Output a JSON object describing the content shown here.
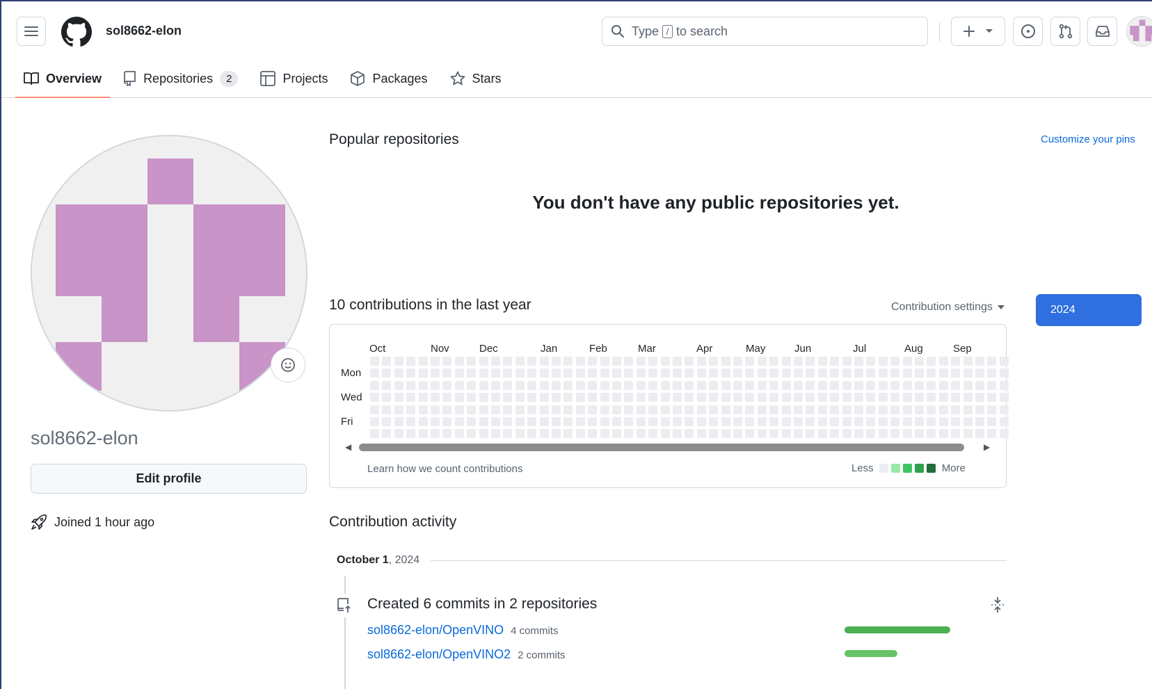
{
  "header": {
    "username": "sol8662-elon",
    "search_prefix": "Type",
    "search_key": "/",
    "search_suffix": "to search"
  },
  "tabs": [
    {
      "label": "Overview",
      "active": true
    },
    {
      "label": "Repositories",
      "count": "2"
    },
    {
      "label": "Projects"
    },
    {
      "label": "Packages"
    },
    {
      "label": "Stars"
    }
  ],
  "profile": {
    "name": "sol8662-elon",
    "edit_label": "Edit profile",
    "joined": "Joined 1 hour ago",
    "avatar_color": "#c994c7"
  },
  "popular": {
    "title": "Popular repositories",
    "customize": "Customize your pins",
    "empty_message": "You don't have any public repositories yet."
  },
  "contributions": {
    "title": "10 contributions in the last year",
    "settings": "Contribution settings",
    "year": "2024",
    "months": [
      "Oct",
      "Nov",
      "Dec",
      "Jan",
      "Feb",
      "Mar",
      "Apr",
      "May",
      "Jun",
      "Jul",
      "Aug",
      "Sep"
    ],
    "days": [
      "Mon",
      "Wed",
      "Fri"
    ],
    "learn": "Learn how we count contributions",
    "legend_less": "Less",
    "legend_more": "More",
    "legend_colors": [
      "#ebedf0",
      "#9be9a8",
      "#40c463",
      "#30a14e",
      "#216e39"
    ],
    "empty_color": "#ebedf0"
  },
  "activity": {
    "title": "Contribution activity",
    "period_month": "October 1",
    "period_year": ", 2024",
    "summary": "Created 6 commits in 2 repositories",
    "repos": [
      {
        "name": "sol8662-elon/OpenVINO",
        "commits": "4 commits",
        "fraction": 1.0,
        "color": "#4caf50"
      },
      {
        "name": "sol8662-elon/OpenVINO2",
        "commits": "2 commits",
        "fraction": 0.5,
        "color": "#66c466"
      }
    ]
  }
}
